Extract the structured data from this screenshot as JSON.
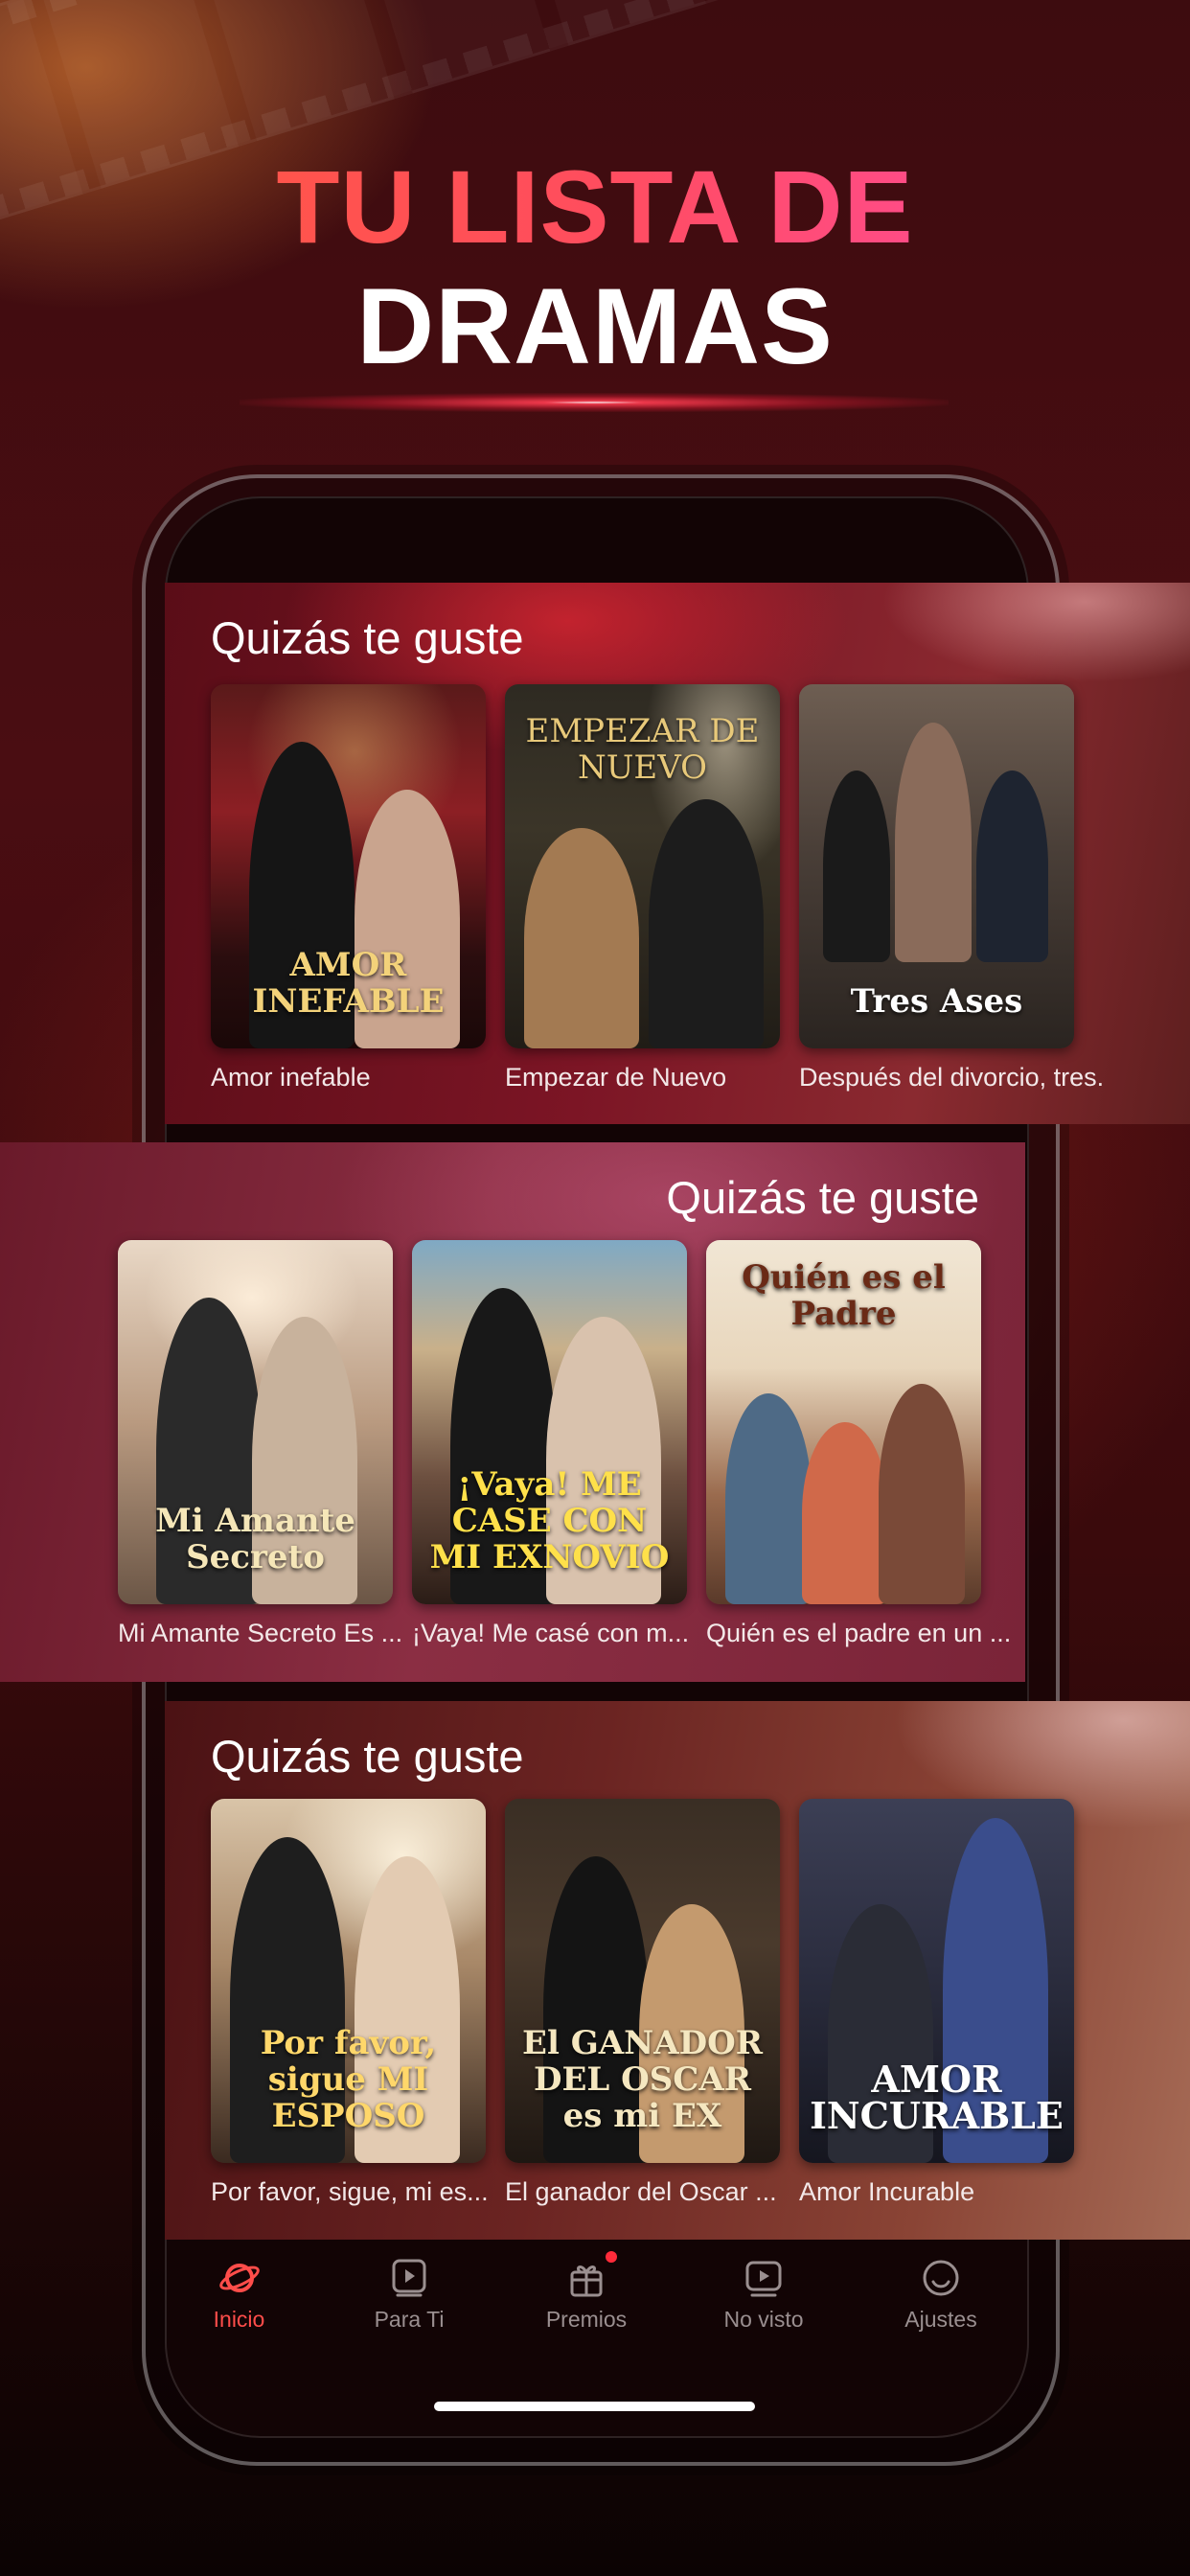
{
  "headline": {
    "line1": "TU LISTA DE",
    "line2": "DRAMAS"
  },
  "sections": [
    {
      "title": "Quizás te guste",
      "cards": [
        {
          "label": "Amor inefable",
          "poster_text": "AMOR INEFABLE"
        },
        {
          "label": "Empezar de Nuevo",
          "poster_text": "EMPEZAR DE NUEVO"
        },
        {
          "label": "Después del divorcio, tres...",
          "poster_text": "Tres Ases"
        }
      ]
    },
    {
      "title": "Quizás te guste",
      "cards": [
        {
          "label": "Mi Amante Secreto Es ...",
          "poster_text": "Mi Amante Secreto"
        },
        {
          "label": "¡Vaya! Me casé con m...",
          "poster_text": "¡Vaya! ME CASE CON MI EXNOVIO"
        },
        {
          "label": "Quién es el padre en un ...",
          "poster_text": "Quién es el Padre"
        }
      ]
    },
    {
      "title": "Quizás te guste",
      "cards": [
        {
          "label": "Por favor, sigue, mi es...",
          "poster_text": "Por favor, sigue MI ESPOSO"
        },
        {
          "label": "El ganador del Oscar ...",
          "poster_text": "El GANADOR DEL OSCAR es mi EX"
        },
        {
          "label": "Amor Incurable",
          "poster_text": "AMOR INCURABLE"
        }
      ]
    }
  ],
  "tabbar": {
    "items": [
      {
        "label": "Inicio",
        "icon": "planet-icon",
        "active": true
      },
      {
        "label": "Para Ti",
        "icon": "play-stack-icon",
        "active": false
      },
      {
        "label": "Premios",
        "icon": "gift-icon",
        "active": false,
        "badge": true
      },
      {
        "label": "No visto",
        "icon": "video-icon",
        "active": false
      },
      {
        "label": "Ajustes",
        "icon": "settings-ring-icon",
        "active": false
      }
    ],
    "active_color": "#ff4d4a",
    "inactive_color": "#9a8f90"
  }
}
